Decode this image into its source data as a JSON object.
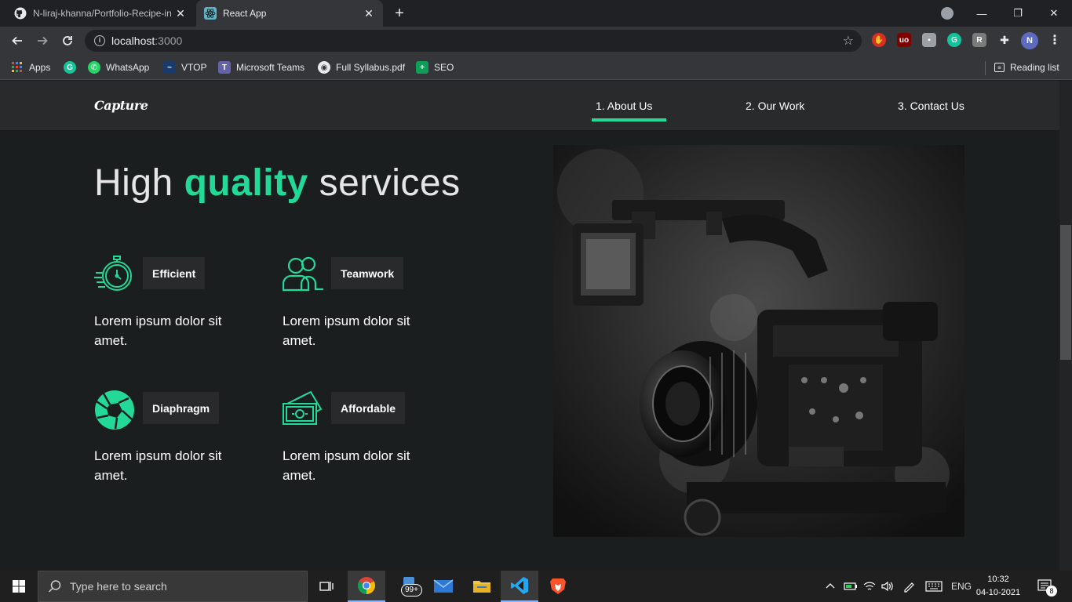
{
  "browser": {
    "tabs": [
      {
        "title": "N-liraj-khanna/Portfolio-Recipe-in",
        "active": false
      },
      {
        "title": "React App",
        "active": true
      }
    ],
    "new_tab": "+",
    "address": {
      "host": "localhost",
      "port": ":3000"
    },
    "window_buttons": {
      "minimize": "—",
      "maximize": "❐",
      "close": "✕"
    },
    "profile_initial": "N",
    "bookmarks": [
      {
        "label": "Apps",
        "icon": "apps-grid-icon"
      },
      {
        "label": "",
        "icon": "grammarly-icon"
      },
      {
        "label": "WhatsApp",
        "icon": "whatsapp-icon"
      },
      {
        "label": "VTOP",
        "icon": "vtop-icon"
      },
      {
        "label": "Microsoft Teams",
        "icon": "teams-icon"
      },
      {
        "label": "Full Syllabus.pdf",
        "icon": "globe-icon"
      },
      {
        "label": "SEO",
        "icon": "sheets-icon"
      }
    ],
    "reading_list": "Reading list"
  },
  "site": {
    "logo": "Capture",
    "nav": [
      {
        "label": "1. About Us",
        "active": true
      },
      {
        "label": "2. Our Work",
        "active": false
      },
      {
        "label": "3. Contact Us",
        "active": false
      }
    ],
    "headline": {
      "before": "High ",
      "accent": "quality",
      "after": " services"
    },
    "services": [
      {
        "title": "Efficient",
        "desc": "Lorem ipsum dolor sit amet.",
        "icon": "stopwatch-icon"
      },
      {
        "title": "Teamwork",
        "desc": "Lorem ipsum dolor sit amet.",
        "icon": "team-icon"
      },
      {
        "title": "Diaphragm",
        "desc": "Lorem ipsum dolor sit amet.",
        "icon": "aperture-icon"
      },
      {
        "title": "Affordable",
        "desc": "Lorem ipsum dolor sit amet.",
        "icon": "money-icon"
      }
    ],
    "accent_color": "#23d997"
  },
  "taskbar": {
    "search_placeholder": "Type here to search",
    "mail_badge": "99+",
    "language": "ENG",
    "time": "10:32",
    "date": "04-10-2021",
    "notifications": "8"
  }
}
